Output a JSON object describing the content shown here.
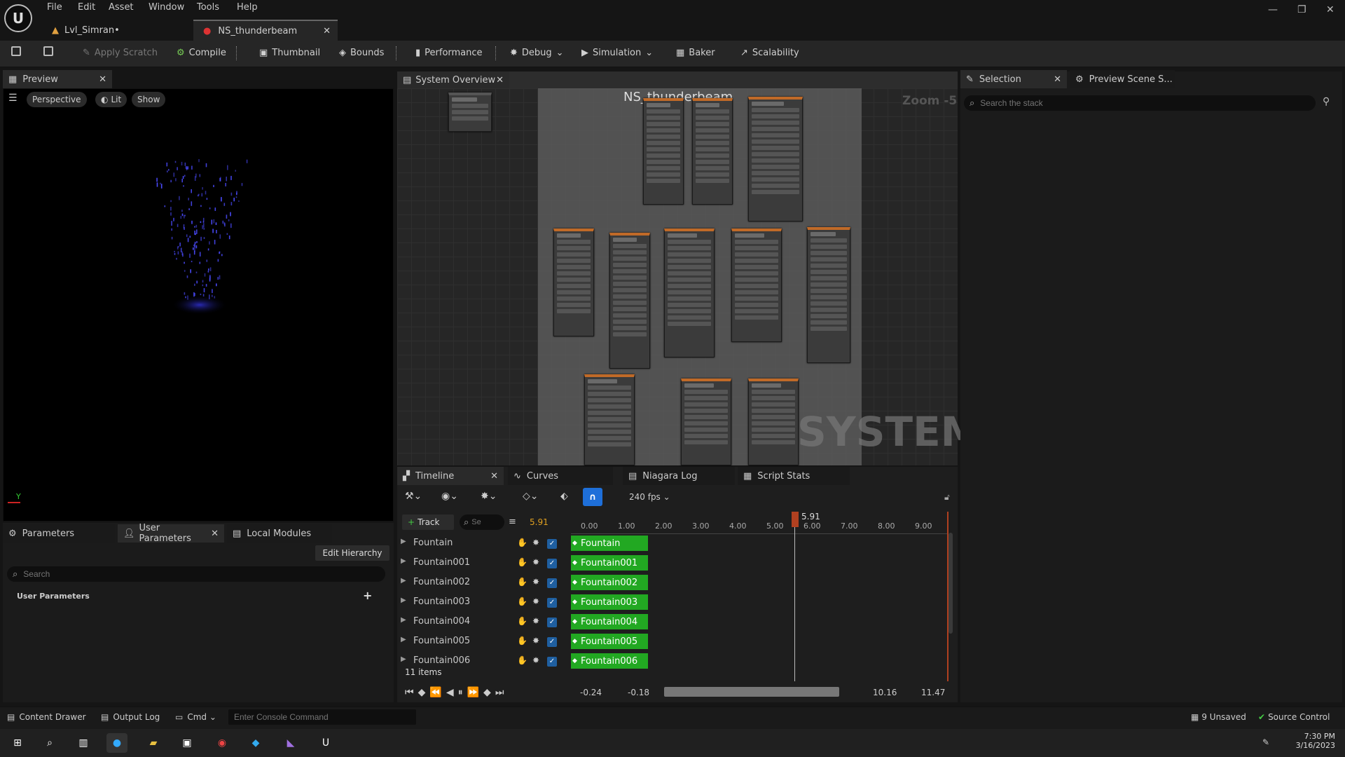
{
  "menu": [
    "File",
    "Edit",
    "Asset",
    "Window",
    "Tools",
    "Help"
  ],
  "tabs": [
    {
      "label": "Lvl_Simran•"
    },
    {
      "label": "NS_thunderbeam"
    }
  ],
  "toolbar": {
    "apply_scratch": "Apply Scratch",
    "compile": "Compile",
    "thumbnail": "Thumbnail",
    "bounds": "Bounds",
    "performance": "Performance",
    "debug": "Debug",
    "simulation": "Simulation",
    "baker": "Baker",
    "scalability": "Scalability"
  },
  "preview": {
    "tab": "Preview",
    "perspective": "Perspective",
    "lit": "Lit",
    "show": "Show"
  },
  "system_overview": {
    "tab": "System Overview",
    "title": "NS_thunderbeam",
    "zoom": "Zoom -5",
    "watermark": "SYSTEM"
  },
  "selection": {
    "tab": "Selection",
    "tab2": "Preview Scene S...",
    "search_placeholder": "Search the stack"
  },
  "bottom_tabs": {
    "timeline": "Timeline",
    "curves": "Curves",
    "niagara_log": "Niagara Log",
    "script_stats": "Script Stats"
  },
  "timeline": {
    "fps": "240 fps",
    "track_btn": "Track",
    "search_placeholder": "Se",
    "current_time": "5.91",
    "playhead": "5.91",
    "ticks": [
      "0.00",
      "1.00",
      "2.00",
      "3.00",
      "4.00",
      "5.00",
      "6.00",
      "7.00",
      "8.00",
      "9.00"
    ],
    "tracks": [
      "Fountain",
      "Fountain001",
      "Fountain002",
      "Fountain003",
      "Fountain004",
      "Fountain005",
      "Fountain006"
    ],
    "items": "11 items",
    "range_start": "-0.24",
    "range_in": "-0.18",
    "range_out": "10.16",
    "range_end": "11.47"
  },
  "params": {
    "tab1": "Parameters",
    "tab2": "User Parameters",
    "tab3": "Local Modules",
    "edit_hierarchy": "Edit Hierarchy",
    "search_placeholder": "Search",
    "section": "User Parameters"
  },
  "statusbar": {
    "content_drawer": "Content Drawer",
    "output_log": "Output Log",
    "cmd": "Cmd",
    "console_placeholder": "Enter Console Command",
    "unsaved": "9 Unsaved",
    "source_control": "Source Control"
  },
  "taskbar": {
    "time": "7:30 PM",
    "date": "3/16/2023"
  },
  "colors": {
    "accent": "#22a822",
    "playhead": "#c0502a",
    "selected": "#1f5fa0"
  }
}
